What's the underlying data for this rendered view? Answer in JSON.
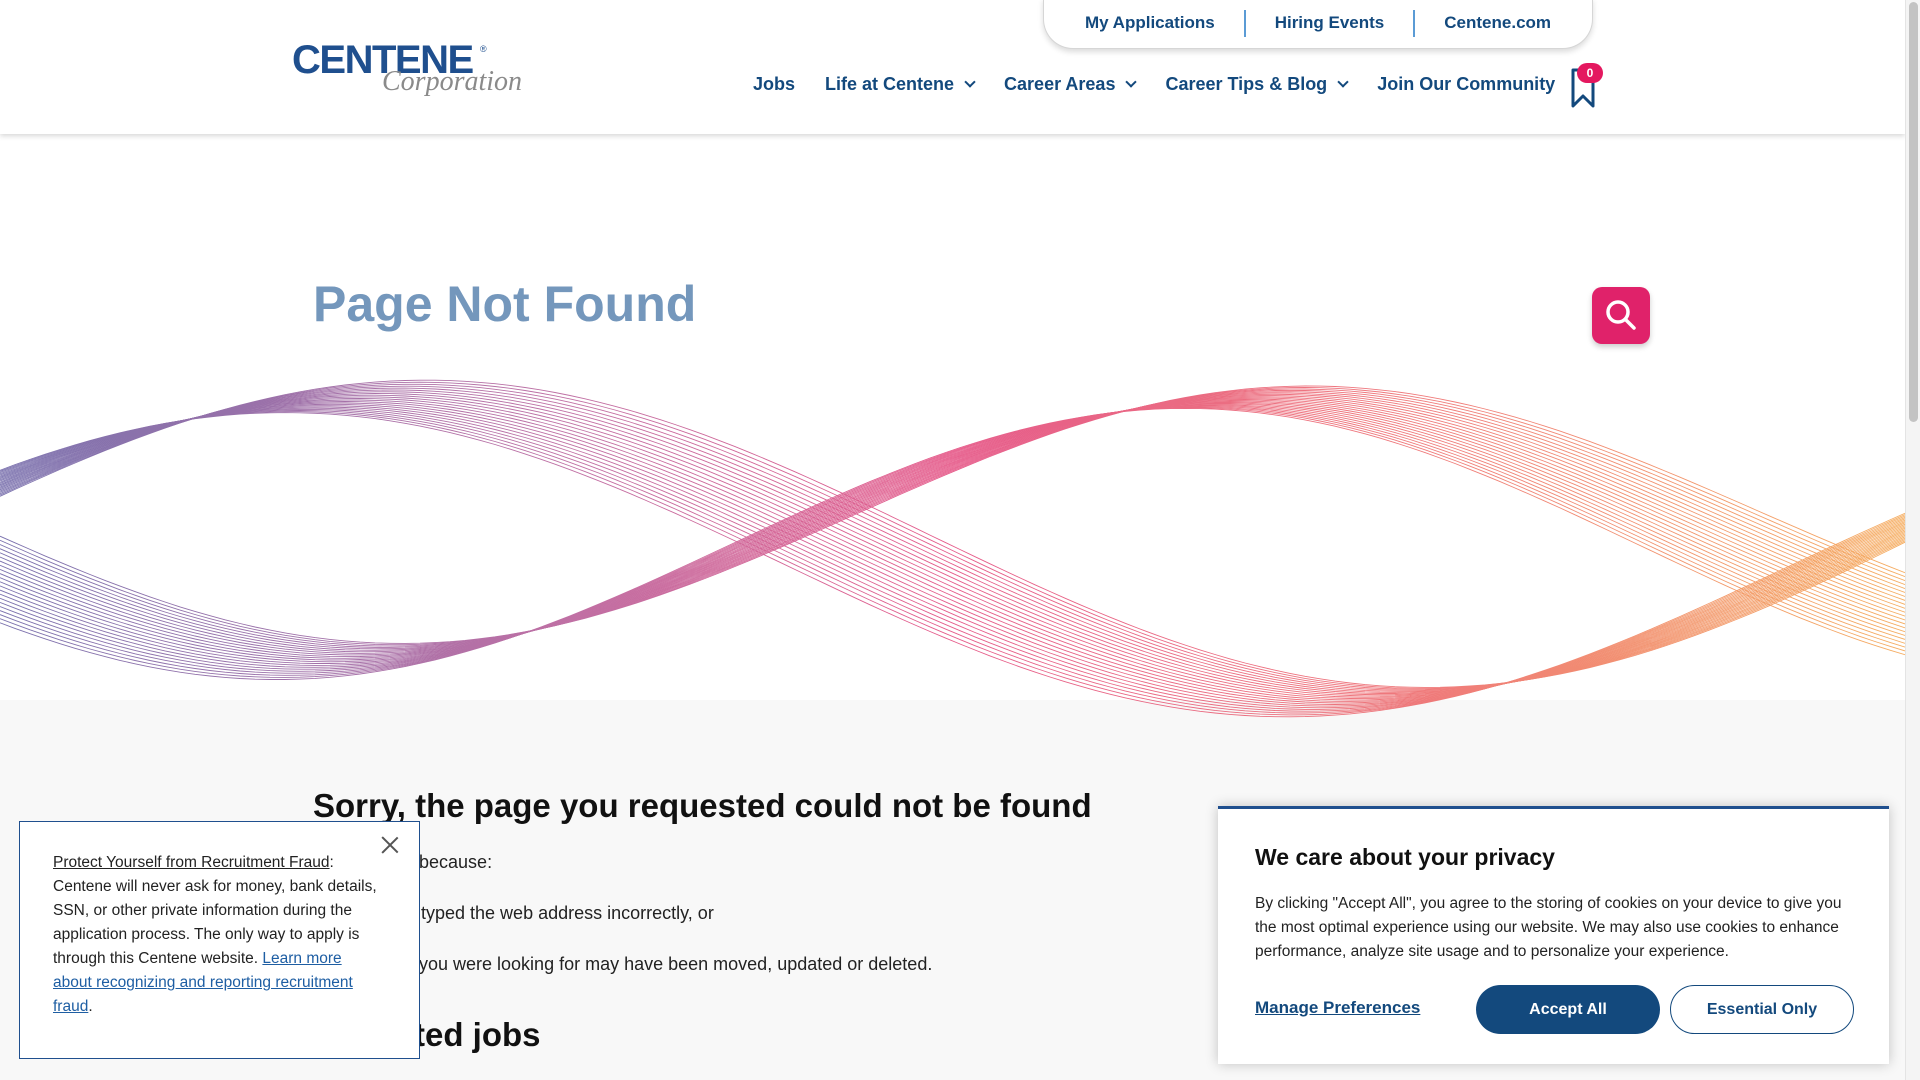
{
  "header": {
    "logo": {
      "main": "CENTENE",
      "registered": "®",
      "sub": "Corporation"
    },
    "utility_links": [
      "My Applications",
      "Hiring Events",
      "Centene.com"
    ],
    "nav": [
      {
        "label": "Jobs",
        "dropdown": false
      },
      {
        "label": "Life at Centene",
        "dropdown": true
      },
      {
        "label": "Career Areas",
        "dropdown": true
      },
      {
        "label": "Career Tips & Blog",
        "dropdown": true
      },
      {
        "label": "Join Our Community",
        "dropdown": false
      }
    ],
    "saved_jobs": {
      "icon": "bookmark-icon",
      "count": "0"
    }
  },
  "hero": {
    "title": "Page Not Found",
    "search_icon": "search-icon"
  },
  "content": {
    "heading": "Sorry, the page you requested could not be found",
    "reason_intro": "e because:",
    "reason_1": "typed the web address incorrectly, or",
    "reason_2": "you were looking for may have been moved, updated or deleted.",
    "subheading": "ted jobs"
  },
  "fraud_notice": {
    "title": "Protect Yourself from Recruitment Fraud",
    "text": ": Centene will never ask for money, bank details, SSN, or other private information during the application process. The only way to apply is through this Centene website. ",
    "link": "Learn more about recognizing and reporting recruitment fraud",
    "end": ".",
    "close_icon": "close-icon"
  },
  "cookie": {
    "title": "We care about your privacy",
    "body": "By clicking \"Accept All\", you agree to the storing of cookies on your device to give you the most optimal experience using our website. We may also use cookies to enhance performance, analyze site usage and to personalize your experience.",
    "manage": "Manage Preferences",
    "accept": "Accept All",
    "essential": "Essential Only"
  },
  "colors": {
    "brand_blue": "#13497d",
    "accent_pink": "#e0226a",
    "title_blue": "#7497bc",
    "wave_purple": "#5a4f9a",
    "wave_pink": "#e0336e",
    "wave_orange": "#f39a3b"
  }
}
